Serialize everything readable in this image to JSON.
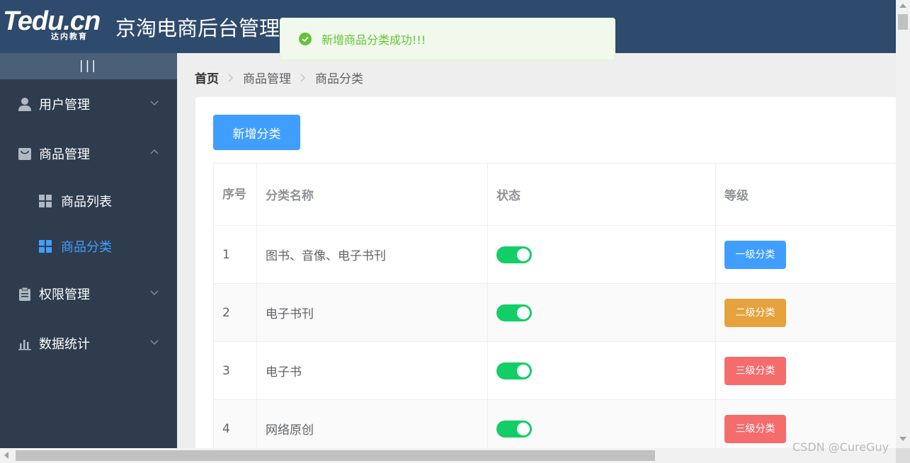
{
  "header": {
    "logo_text": "Tedu.cn",
    "logo_sub": "达内教育",
    "title": "京淘电商后台管理系统"
  },
  "toast": {
    "message": "新增商品分类成功!!!"
  },
  "sidebar": {
    "collapse_label": "|||",
    "menus": [
      {
        "label": "用户管理",
        "icon": "user-icon",
        "expanded": false
      },
      {
        "label": "商品管理",
        "icon": "shopping-bag-icon",
        "expanded": true
      },
      {
        "label": "权限管理",
        "icon": "clipboard-icon",
        "expanded": false
      },
      {
        "label": "数据统计",
        "icon": "bar-chart-icon",
        "expanded": false
      }
    ],
    "submenu": [
      {
        "label": "商品列表",
        "icon": "grid-icon",
        "active": false
      },
      {
        "label": "商品分类",
        "icon": "grid-icon",
        "active": true
      }
    ]
  },
  "breadcrumb": [
    "首页",
    "商品管理",
    "商品分类"
  ],
  "toolbar": {
    "add_label": "新增分类"
  },
  "table": {
    "columns": [
      "序号",
      "分类名称",
      "状态",
      "等级"
    ],
    "rows": [
      {
        "index": "1",
        "name": "图书、音像、电子书刊",
        "status": true,
        "level": "一级分类"
      },
      {
        "index": "2",
        "name": "电子书刊",
        "status": true,
        "level": "二级分类"
      },
      {
        "index": "3",
        "name": "电子书",
        "status": true,
        "level": "三级分类"
      },
      {
        "index": "4",
        "name": "网络原创",
        "status": true,
        "level": "三级分类"
      }
    ]
  },
  "watermark": "CSDN @CureGuy",
  "colors": {
    "header_bg": "#2e4a6c",
    "sidebar_bg": "#2f3c4e",
    "primary": "#409eff",
    "success": "#67c23a",
    "switch_on": "#13ce66",
    "warning": "#e6a23c",
    "danger": "#f56c6c"
  }
}
